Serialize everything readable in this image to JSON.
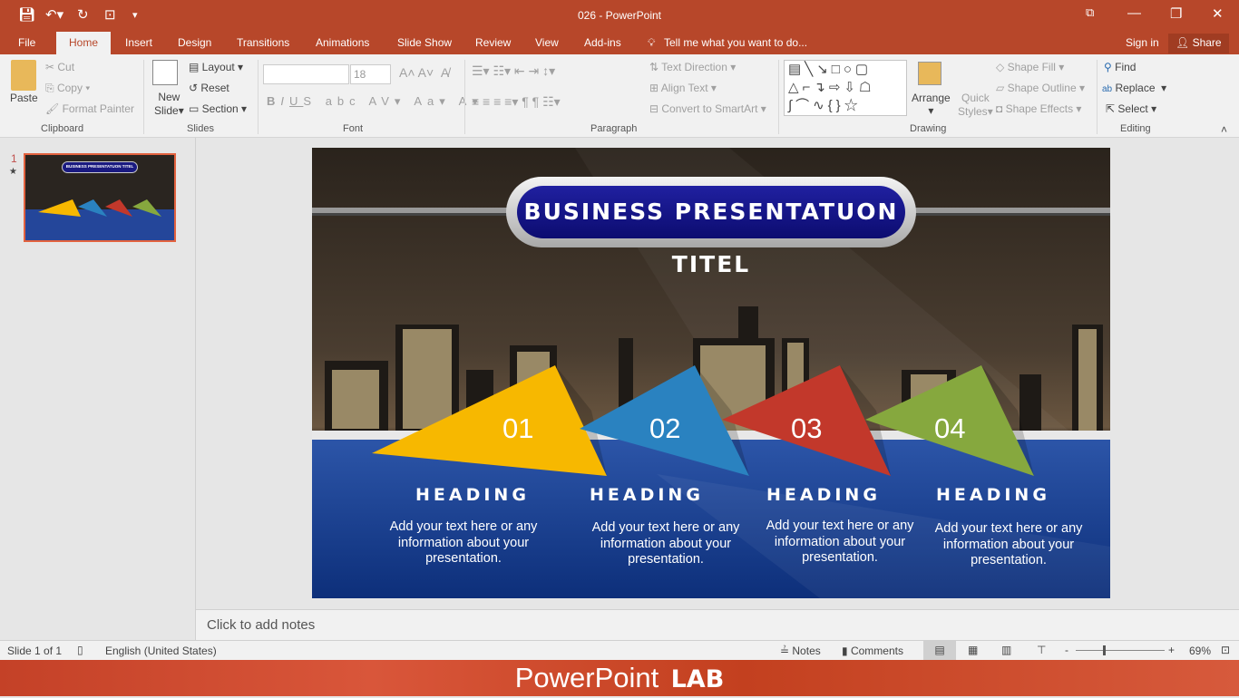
{
  "window": {
    "title": "026 - PowerPoint",
    "sign_in": "Sign in",
    "share": "Share"
  },
  "tabs": [
    "File",
    "Home",
    "Insert",
    "Design",
    "Transitions",
    "Animations",
    "Slide Show",
    "Review",
    "View",
    "Add-ins"
  ],
  "tell_me": "Tell me what you want to do...",
  "ribbon": {
    "clipboard": {
      "paste": "Paste",
      "cut": "Cut",
      "copy": "Copy",
      "format_painter": "Format Painter",
      "label": "Clipboard"
    },
    "slides": {
      "new_slide": "New",
      "new_slide2": "Slide",
      "layout": "Layout",
      "reset": "Reset",
      "section": "Section",
      "label": "Slides"
    },
    "font": {
      "font_name": "",
      "font_size": "18",
      "label": "Font"
    },
    "paragraph": {
      "text_direction": "Text Direction",
      "align_text": "Align Text",
      "convert": "Convert to SmartArt",
      "label": "Paragraph"
    },
    "drawing": {
      "arrange": "Arrange",
      "quick_styles": "Quick",
      "quick_styles2": "Styles",
      "shape_fill": "Shape Fill",
      "shape_outline": "Shape Outline",
      "shape_effects": "Shape Effects",
      "label": "Drawing"
    },
    "editing": {
      "find": "Find",
      "replace": "Replace",
      "select": "Select",
      "label": "Editing"
    }
  },
  "thumbnail": {
    "number": "1",
    "title": "BUSINESS PRESENTATUON TITEL"
  },
  "slide": {
    "title": "BUSINESS PRESENTATUON TITEL",
    "items": [
      {
        "num": "01",
        "heading": "HEADING",
        "body": "Add your text here or any information about your  presentation.",
        "color": "#f7b800"
      },
      {
        "num": "02",
        "heading": "HEADING",
        "body": "Add your text here or any information about your  presentation.",
        "color": "#2a82c0"
      },
      {
        "num": "03",
        "heading": "HEADING",
        "body": "Add your text here or any information about your  presentation.",
        "color": "#c2382b"
      },
      {
        "num": "04",
        "heading": "HEADING",
        "body": "Add your text here or any information about your  presentation.",
        "color": "#86a83e"
      }
    ]
  },
  "notes_placeholder": "Click to add notes",
  "status": {
    "slide": "Slide 1 of 1",
    "language": "English (United States)",
    "notes": "Notes",
    "comments": "Comments",
    "zoom": "69%"
  },
  "banner": {
    "text1": "PowerPoint",
    "text2": "LAB"
  }
}
